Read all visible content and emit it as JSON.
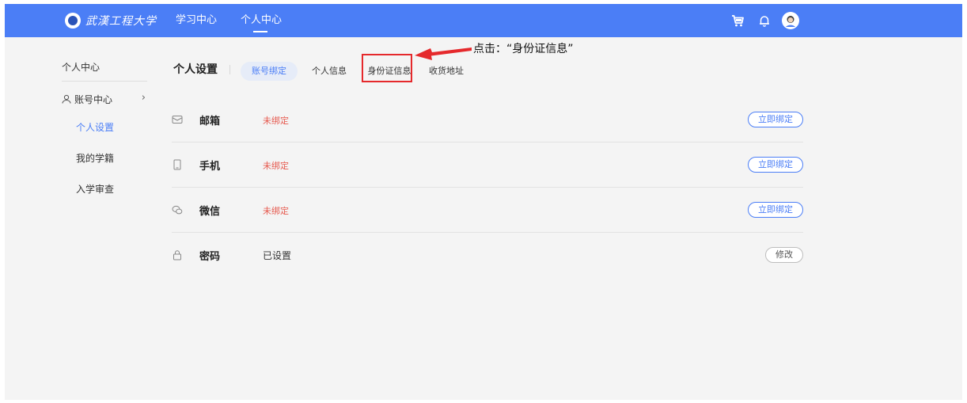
{
  "header": {
    "logo_text": "武漢工程大学",
    "nav": [
      {
        "label": "学习中心"
      },
      {
        "label": "个人中心"
      }
    ],
    "icons": [
      "cart-icon",
      "bell-icon",
      "avatar-icon"
    ]
  },
  "sidebar": {
    "title": "个人中心",
    "group": {
      "label": "账号中心",
      "chevron": "›"
    },
    "items": [
      {
        "label": "个人设置",
        "active": true
      },
      {
        "label": "我的学籍"
      },
      {
        "label": "入学审查"
      }
    ]
  },
  "main": {
    "title": "个人设置",
    "tabs": [
      {
        "label": "账号绑定",
        "active": true
      },
      {
        "label": "个人信息"
      },
      {
        "label": "身份证信息"
      },
      {
        "label": "收货地址"
      }
    ],
    "annotation": "点击：“身份证信息”",
    "rows": [
      {
        "icon": "mail-icon",
        "label": "邮箱",
        "status": "未绑定",
        "button": "立即绑定"
      },
      {
        "icon": "phone-icon",
        "label": "手机",
        "status": "未绑定",
        "button": "立即绑定"
      },
      {
        "icon": "wechat-icon",
        "label": "微信",
        "status": "未绑定",
        "button": "立即绑定"
      },
      {
        "icon": "lock-icon",
        "label": "密码",
        "status": "已设置",
        "button": "修改"
      }
    ]
  },
  "colors": {
    "topbar": "#4b7ef6",
    "accent": "#4b7ef6",
    "unbound": "#e65a4f",
    "highlight": "#e5292c"
  }
}
